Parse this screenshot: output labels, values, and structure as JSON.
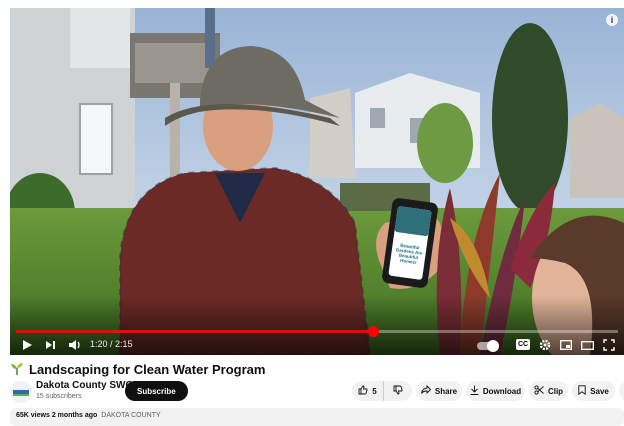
{
  "player": {
    "current_time": "1:20",
    "duration": "2:15",
    "time_text": "1:20 / 2:15",
    "progress_fraction": 0.593,
    "phone_screen_text": "Beautiful Gardens Are Beautiful Homes!",
    "cc_label": "CC"
  },
  "video": {
    "title": "Landscaping for Clean Water Program"
  },
  "channel": {
    "name": "Dakota County SWCD",
    "subscribers": "15 subscribers",
    "subscribe_label": "Subscribe"
  },
  "actions": {
    "like_count": "5",
    "share_label": "Share",
    "download_label": "Download",
    "clip_label": "Clip",
    "save_label": "Save"
  },
  "description": {
    "views": "65K views",
    "age": "2 months ago",
    "tag": "DAKOTA COUNTY"
  },
  "colors": {
    "progress": "#ff0000",
    "subscribe_bg": "#0f0f0f",
    "pill_bg": "#f2f2f2"
  },
  "icons": [
    "play-icon",
    "next-icon",
    "volume-icon",
    "autoplay-toggle",
    "cc-icon",
    "settings-icon",
    "miniplayer-icon",
    "theater-icon",
    "fullscreen-icon",
    "like-icon",
    "dislike-icon",
    "share-icon",
    "download-icon",
    "clip-icon",
    "save-icon",
    "more-icon",
    "info-icon"
  ]
}
